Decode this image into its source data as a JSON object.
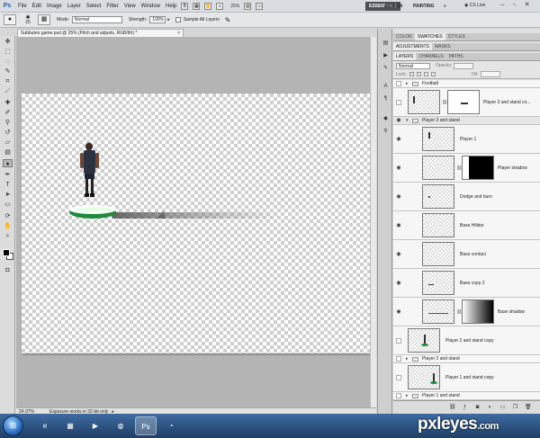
{
  "app": {
    "logo": "Ps",
    "zoom": "25%"
  },
  "menu": [
    "File",
    "Edit",
    "Image",
    "Layer",
    "Select",
    "Filter",
    "View",
    "Window",
    "Help"
  ],
  "workspaces": [
    "ESSENTIALS",
    "DESIGN",
    "PAINTING",
    "»"
  ],
  "cslive": "CS Live",
  "options": {
    "brush_size": "25",
    "mode_label": "Mode:",
    "mode_value": "Normal",
    "strength_label": "Strength:",
    "strength_value": "100%",
    "sample_label": "Sample All Layers"
  },
  "document": {
    "tab_title": "Subbuteo game.psd @ 25% (Pitch and adjusts, RGB/8#) *",
    "status_zoom": "24.97%",
    "status_info": "Exposure works in 32-bit only"
  },
  "panel": {
    "top_tabs": [
      "COLOR",
      "SWATCHES",
      "STYLES"
    ],
    "mid_tabs": [
      "ADJUSTMENTS",
      "MASKS"
    ],
    "layer_tabs": [
      "LAYERS",
      "CHANNELS",
      "PATHS"
    ],
    "blend_mode": "Normal",
    "opacity_label": "Opacity:",
    "fill_label": "Fill:",
    "lock_label": "Lock:"
  },
  "layers": [
    {
      "name": "Football",
      "kind": "group"
    },
    {
      "name": "Player 3 and stand co...",
      "kind": "layer-mask"
    },
    {
      "name": "Player 3 and stand",
      "kind": "group"
    },
    {
      "name": "Player 1",
      "kind": "layer"
    },
    {
      "name": "Player shadow",
      "kind": "layer-mask"
    },
    {
      "name": "Dodge and burn",
      "kind": "layer"
    },
    {
      "name": "Base Hilites",
      "kind": "layer"
    },
    {
      "name": "Base contact",
      "kind": "layer"
    },
    {
      "name": "Base copy 2",
      "kind": "layer"
    },
    {
      "name": "Base shadow",
      "kind": "layer-mask"
    },
    {
      "name": "Player 2 and stand copy",
      "kind": "layer"
    },
    {
      "name": "Player 2 and stand",
      "kind": "group"
    },
    {
      "name": "Player 1 and stand copy",
      "kind": "layer"
    },
    {
      "name": "Player 1 and stand",
      "kind": "group"
    }
  ],
  "watermark": {
    "brand": "pxleyes",
    "suffix": ".com"
  },
  "colors": {
    "accent_essentials": "#4b4f55",
    "taskbar": "#1f3f66"
  }
}
